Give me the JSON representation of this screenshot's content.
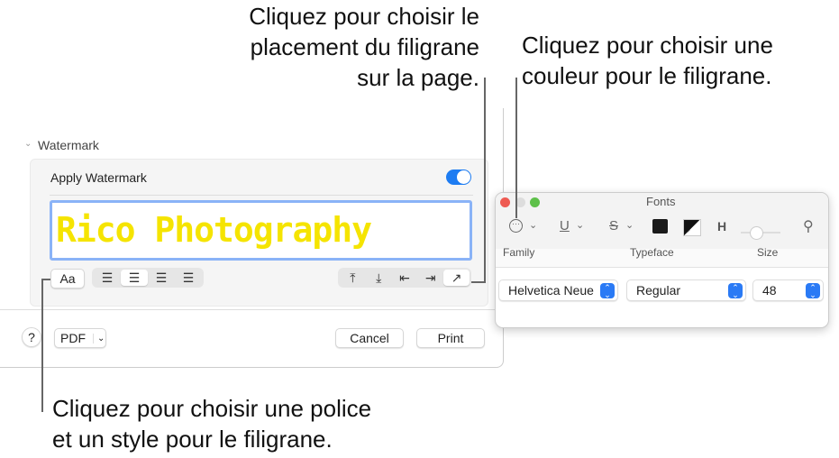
{
  "callouts": {
    "placement": [
      "Cliquez pour choisir le",
      "placement du filigrane",
      "sur la page."
    ],
    "color": [
      "Cliquez pour choisir une",
      "couleur pour le filigrane."
    ],
    "font": [
      "Cliquez pour choisir une police",
      "et un style pour le filigrane."
    ]
  },
  "dialog": {
    "section_title": "Watermark",
    "apply_label": "Apply Watermark",
    "apply_on": true,
    "watermark_text": "Rico Photography",
    "watermark_color": "#f5e400",
    "font_button": "Aa",
    "help": "?",
    "pdf": "PDF",
    "cancel": "Cancel",
    "print": "Print"
  },
  "fonts": {
    "title": "Fonts",
    "columns": [
      "Family",
      "Typeface",
      "Size"
    ],
    "family": "Helvetica Neue",
    "typeface": "Regular",
    "size": "48"
  }
}
